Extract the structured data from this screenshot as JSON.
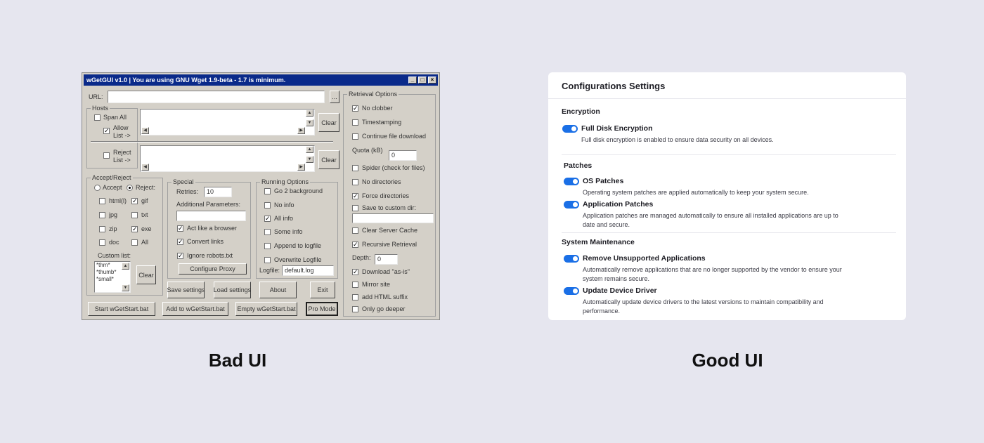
{
  "bad_ui": {
    "title": "wGetGUI v1.0   |  You are using GNU Wget 1.9-beta - 1.7 is minimum.",
    "url_label": "URL:",
    "url_button": "...",
    "hosts": {
      "title": "Hosts",
      "span_all": "Span All",
      "allow_list": "Allow List ->",
      "reject_list": "Reject List ->",
      "clear": "Clear"
    },
    "accept_reject": {
      "title": "Accept/Reject",
      "accept": "Accept",
      "reject": "Reject:",
      "types": [
        {
          "label": "html(l)",
          "checked": false
        },
        {
          "label": "gif",
          "checked": true
        },
        {
          "label": "jpg",
          "checked": false
        },
        {
          "label": "txt",
          "checked": false
        },
        {
          "label": "zip",
          "checked": false
        },
        {
          "label": "exe",
          "checked": true
        },
        {
          "label": "doc",
          "checked": false
        },
        {
          "label": "All",
          "checked": false
        }
      ],
      "custom_list_label": "Custom list:",
      "custom_list_items": [
        "*thm*",
        "*thumb*",
        "*small*"
      ],
      "clear": "Clear"
    },
    "special": {
      "title": "Special",
      "retries_label": "Retries:",
      "retries_value": "10",
      "additional_label": "Additional Parameters:",
      "act_like_browser": "Act like a browser",
      "convert_links": "Convert links",
      "ignore_robots": "Ignore robots.txt",
      "configure_proxy": "Configure Proxy"
    },
    "running": {
      "title": "Running Options",
      "options": [
        {
          "label": "Go 2 background",
          "checked": false
        },
        {
          "label": "No info",
          "checked": false
        },
        {
          "label": "All info",
          "checked": true
        },
        {
          "label": "Some info",
          "checked": false
        },
        {
          "label": "Append to logfile",
          "checked": false
        },
        {
          "label": "Overwrite Logfile",
          "checked": false
        }
      ],
      "logfile_label": "Logfile:",
      "logfile_value": "default.log"
    },
    "retrieval": {
      "title": "Retrieval Options",
      "no_clobber": "No clobber",
      "timestamping": "Timestamping",
      "continue_download": "Continue file download",
      "quota_label": "Quota (kB)",
      "quota_value": "0",
      "spider": "Spider (check for files)",
      "no_directories": "No directories",
      "force_directories": "Force directories",
      "save_custom_dir": "Save to custom dir:",
      "clear_server_cache": "Clear Server Cache",
      "recursive_retrieval": "Recursive Retrieval",
      "depth_label": "Depth:",
      "depth_value": "0",
      "download_as_is": "Download \"as-is\"",
      "mirror_site": "Mirror site",
      "add_html_suffix": "add HTML suffix",
      "only_go_deeper": "Only go deeper"
    },
    "buttons": {
      "save_settings": "Save settings",
      "load_settings": "Load settings",
      "about": "About",
      "exit": "Exit",
      "start": "Start wGetStart.bat",
      "add": "Add to wGetStart.bat",
      "empty": "Empty wGetStart.bat",
      "pro_mode": "Pro Mode"
    }
  },
  "good_ui": {
    "title": "Configurations Settings",
    "accent_color": "#1a6fe6",
    "sections": {
      "encryption": {
        "title": "Encryption",
        "options": [
          {
            "title": "Full Disk Encryption",
            "desc": "Full disk encryption is enabled to ensure data security on all devices.",
            "enabled": true
          }
        ]
      },
      "patches": {
        "title": "Patches",
        "options": [
          {
            "title": "OS Patches",
            "desc": "Operating system patches are applied automatically to keep your system secure.",
            "enabled": true
          },
          {
            "title": "Application Patches",
            "desc": "Application patches are managed automatically to ensure all installed applications are up to date and secure.",
            "enabled": true
          }
        ]
      },
      "maintenance": {
        "title": "System Maintenance",
        "options": [
          {
            "title": "Remove Unsupported Applications",
            "desc": "Automatically remove applications that are no longer supported by the vendor to ensure your system remains secure.",
            "enabled": true
          },
          {
            "title": "Update Device Driver",
            "desc": "Automatically update device drivers to the latest versions to maintain compatibility and performance.",
            "enabled": true
          }
        ]
      }
    }
  },
  "captions": {
    "bad": "Bad UI",
    "good": "Good UI"
  }
}
